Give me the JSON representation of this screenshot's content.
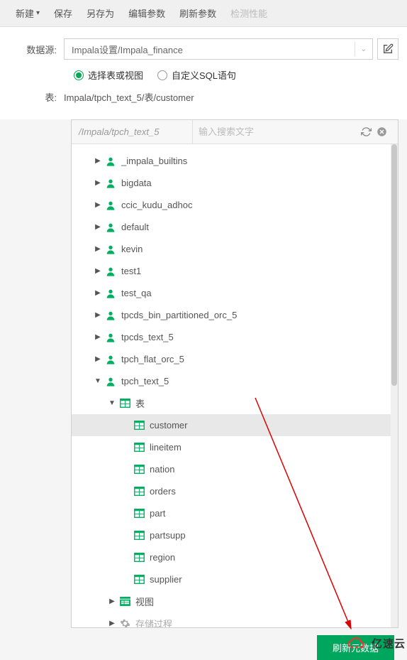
{
  "toolbar": {
    "new": "新建",
    "save": "保存",
    "saveAs": "另存为",
    "editParams": "编辑参数",
    "refreshParams": "刷新参数",
    "checkPerf": "检测性能"
  },
  "form": {
    "datasourceLabel": "数据源:",
    "datasourceValue": "Impala设置/Impala_finance",
    "radio1": "选择表或视图",
    "radio2": "自定义SQL语句",
    "tableLabel": "表:",
    "tableValue": "Impala/tpch_text_5/表/customer"
  },
  "browser": {
    "path": "/Impala/tpch_text_5",
    "searchPlaceholder": "输入搜索文字"
  },
  "tree": {
    "databases": [
      {
        "name": "_impala_builtins",
        "expanded": false
      },
      {
        "name": "bigdata",
        "expanded": false
      },
      {
        "name": "ccic_kudu_adhoc",
        "expanded": false
      },
      {
        "name": "default",
        "expanded": false
      },
      {
        "name": "kevin",
        "expanded": false
      },
      {
        "name": "test1",
        "expanded": false
      },
      {
        "name": "test_qa",
        "expanded": false
      },
      {
        "name": "tpcds_bin_partitioned_orc_5",
        "expanded": false
      },
      {
        "name": "tpcds_text_5",
        "expanded": false
      },
      {
        "name": "tpch_flat_orc_5",
        "expanded": false
      },
      {
        "name": "tpch_text_5",
        "expanded": true
      }
    ],
    "tablesFolder": "表",
    "tables": [
      "customer",
      "lineitem",
      "nation",
      "orders",
      "part",
      "partsupp",
      "region",
      "supplier"
    ],
    "selectedTable": "customer",
    "viewsFolder": "视图",
    "procFolder": "存储过程"
  },
  "footer": {
    "refreshBtn": "刷新元数据"
  },
  "watermark": "亿速云"
}
